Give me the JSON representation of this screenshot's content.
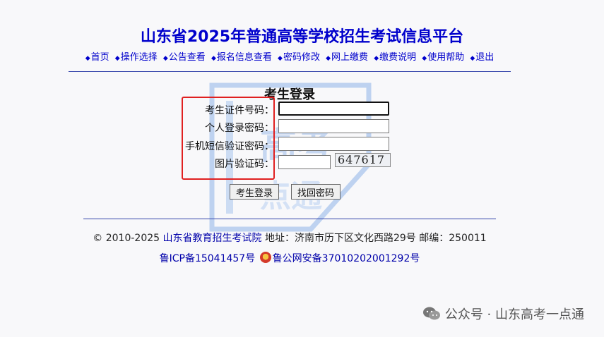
{
  "header": {
    "title": "山东省2025年普通高等学校招生考试信息平台"
  },
  "nav": [
    {
      "label": "首页"
    },
    {
      "label": "操作选择"
    },
    {
      "label": "公告查看"
    },
    {
      "label": "报名信息查看"
    },
    {
      "label": "密码修改"
    },
    {
      "label": "网上缴费"
    },
    {
      "label": "缴费说明"
    },
    {
      "label": "使用帮助"
    },
    {
      "label": "退出"
    }
  ],
  "login": {
    "title": "考生登录",
    "id_label": "考生证件号码：",
    "password_label": "个人登录密码：",
    "sms_label": "手机短信验证密码：",
    "captcha_label": "图片验证码：",
    "captcha_text": "647617",
    "login_button": "考生登录",
    "recover_button": "找回密码"
  },
  "footer": {
    "copyright": "© 2010-2025 ",
    "org_link": "山东省教育招生考试院",
    "address": " 地址：济南市历下区文化西路29号 邮编：250011",
    "icp": "鲁ICP备15041457号",
    "police": "鲁公网安备37010202001292号"
  },
  "watermark": {
    "account": "公众号 · 山东高考一点通",
    "logo_text": "高考一点通"
  },
  "colors": {
    "nav_blue": "#0000cc",
    "highlight_red": "#e02020"
  }
}
